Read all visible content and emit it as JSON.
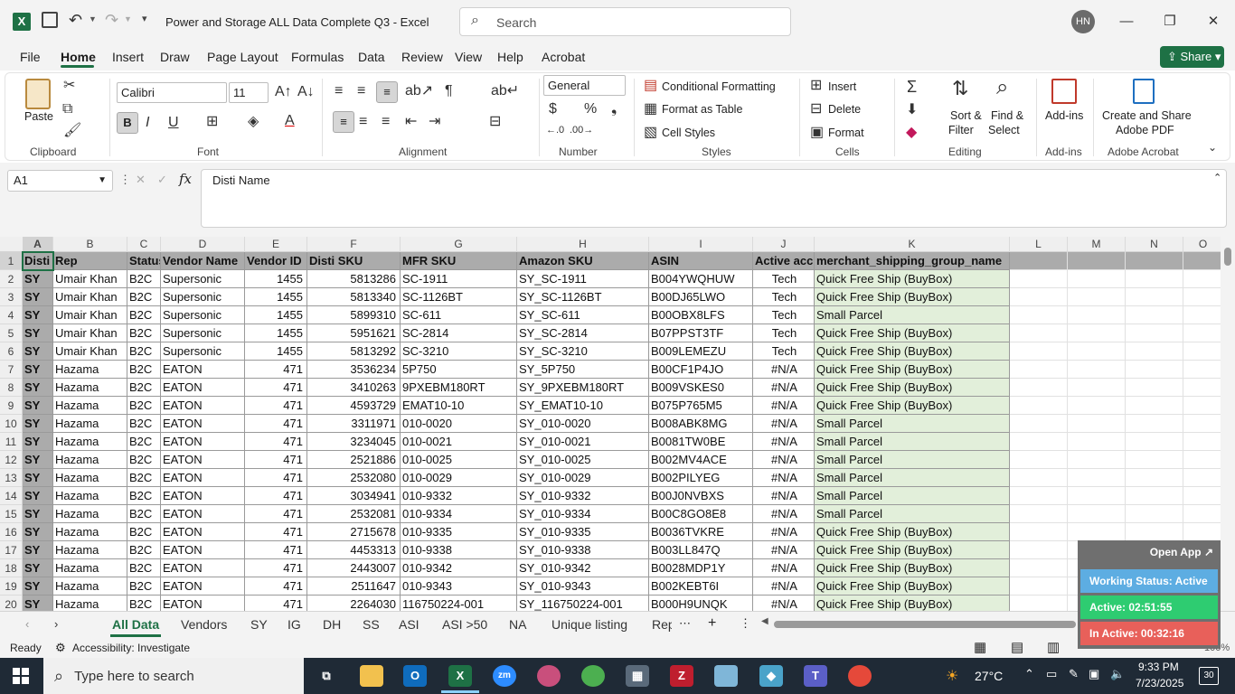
{
  "window": {
    "title": "Power and Storage ALL Data Complete Q3  -  Excel",
    "search_placeholder": "Search",
    "user_initials": "HN"
  },
  "menu": {
    "items": [
      "File",
      "Home",
      "Insert",
      "Draw",
      "Page Layout",
      "Formulas",
      "Data",
      "Review",
      "View",
      "Help",
      "Acrobat"
    ],
    "share_label": "Share"
  },
  "ribbon": {
    "clipboard": {
      "paste": "Paste",
      "label": "Clipboard"
    },
    "font": {
      "name": "Calibri",
      "size": "11",
      "label": "Font"
    },
    "alignment": {
      "label": "Alignment"
    },
    "number": {
      "format": "General",
      "label": "Number"
    },
    "styles": {
      "conditional": "Conditional Formatting",
      "format_table": "Format as Table",
      "cell_styles": "Cell Styles",
      "label": "Styles"
    },
    "cells": {
      "insert": "Insert",
      "delete": "Delete",
      "format": "Format",
      "label": "Cells"
    },
    "editing": {
      "sort1": "Sort &",
      "sort2": "Filter",
      "find1": "Find &",
      "find2": "Select",
      "label": "Editing"
    },
    "addins": {
      "btn": "Add-ins",
      "label": "Add-ins"
    },
    "acrobat": {
      "btn1": "Create and Share",
      "btn2": "Adobe PDF",
      "label": "Adobe Acrobat"
    }
  },
  "formula_bar": {
    "name_box": "A1",
    "value": "Disti Name"
  },
  "columns": [
    "A",
    "B",
    "C",
    "D",
    "E",
    "F",
    "G",
    "H",
    "I",
    "J",
    "K",
    "L",
    "M",
    "N",
    "O"
  ],
  "header_row": [
    "Disti",
    "Rep",
    "Status",
    "Vendor Name",
    "Vendor ID",
    "Disti SKU",
    "MFR SKU",
    "Amazon SKU",
    "ASIN",
    "Active acc",
    "merchant_shipping_group_name"
  ],
  "rows": [
    [
      "SY",
      "Umair Khan",
      "B2C",
      "Supersonic",
      "1455",
      "5813286",
      "SC-1911",
      "SY_SC-1911",
      "B004YWQHUW",
      "Tech",
      "Quick Free Ship (BuyBox)"
    ],
    [
      "SY",
      "Umair Khan",
      "B2C",
      "Supersonic",
      "1455",
      "5813340",
      "SC-1126BT",
      "SY_SC-1126BT",
      "B00DJ65LWO",
      "Tech",
      "Quick Free Ship (BuyBox)"
    ],
    [
      "SY",
      "Umair Khan",
      "B2C",
      "Supersonic",
      "1455",
      "5899310",
      "SC-611",
      "SY_SC-611",
      "B00OBX8LFS",
      "Tech",
      "Small Parcel"
    ],
    [
      "SY",
      "Umair Khan",
      "B2C",
      "Supersonic",
      "1455",
      "5951621",
      "SC-2814",
      "SY_SC-2814",
      "B07PPST3TF",
      "Tech",
      "Quick Free Ship (BuyBox)"
    ],
    [
      "SY",
      "Umair Khan",
      "B2C",
      "Supersonic",
      "1455",
      "5813292",
      "SC-3210",
      "SY_SC-3210",
      "B009LEMEZU",
      "Tech",
      "Quick Free Ship (BuyBox)"
    ],
    [
      "SY",
      "Hazama",
      "B2C",
      "EATON",
      "471",
      "3536234",
      "5P750",
      "SY_5P750",
      "B00CF1P4JO",
      "#N/A",
      "Quick Free Ship (BuyBox)"
    ],
    [
      "SY",
      "Hazama",
      "B2C",
      "EATON",
      "471",
      "3410263",
      "9PXEBM180RT",
      "SY_9PXEBM180RT",
      "B009VSKES0",
      "#N/A",
      "Quick Free Ship (BuyBox)"
    ],
    [
      "SY",
      "Hazama",
      "B2C",
      "EATON",
      "471",
      "4593729",
      "EMAT10-10",
      "SY_EMAT10-10",
      "B075P765M5",
      "#N/A",
      "Quick Free Ship (BuyBox)"
    ],
    [
      "SY",
      "Hazama",
      "B2C",
      "EATON",
      "471",
      "3311971",
      "010-0020",
      "SY_010-0020",
      "B008ABK8MG",
      "#N/A",
      "Small Parcel"
    ],
    [
      "SY",
      "Hazama",
      "B2C",
      "EATON",
      "471",
      "3234045",
      "010-0021",
      "SY_010-0021",
      "B0081TW0BE",
      "#N/A",
      "Small Parcel"
    ],
    [
      "SY",
      "Hazama",
      "B2C",
      "EATON",
      "471",
      "2521886",
      "010-0025",
      "SY_010-0025",
      "B002MV4ACE",
      "#N/A",
      "Small Parcel"
    ],
    [
      "SY",
      "Hazama",
      "B2C",
      "EATON",
      "471",
      "2532080",
      "010-0029",
      "SY_010-0029",
      "B002PILYEG",
      "#N/A",
      "Small Parcel"
    ],
    [
      "SY",
      "Hazama",
      "B2C",
      "EATON",
      "471",
      "3034941",
      "010-9332",
      "SY_010-9332",
      "B00J0NVBXS",
      "#N/A",
      "Small Parcel"
    ],
    [
      "SY",
      "Hazama",
      "B2C",
      "EATON",
      "471",
      "2532081",
      "010-9334",
      "SY_010-9334",
      "B00C8GO8E8",
      "#N/A",
      "Small Parcel"
    ],
    [
      "SY",
      "Hazama",
      "B2C",
      "EATON",
      "471",
      "2715678",
      "010-9335",
      "SY_010-9335",
      "B0036TVKRE",
      "#N/A",
      "Quick Free Ship (BuyBox)"
    ],
    [
      "SY",
      "Hazama",
      "B2C",
      "EATON",
      "471",
      "4453313",
      "010-9338",
      "SY_010-9338",
      "B003LL847Q",
      "#N/A",
      "Quick Free Ship (BuyBox)"
    ],
    [
      "SY",
      "Hazama",
      "B2C",
      "EATON",
      "471",
      "2443007",
      "010-9342",
      "SY_010-9342",
      "B0028MDP1Y",
      "#N/A",
      "Quick Free Ship (BuyBox)"
    ],
    [
      "SY",
      "Hazama",
      "B2C",
      "EATON",
      "471",
      "2511647",
      "010-9343",
      "SY_010-9343",
      "B002KEBT6I",
      "#N/A",
      "Quick Free Ship (BuyBox)"
    ],
    [
      "SY",
      "Hazama",
      "B2C",
      "EATON",
      "471",
      "2264030",
      "116750224-001",
      "SY_116750224-001",
      "B000H9UNQK",
      "#N/A",
      "Quick Free Ship (BuyBox)"
    ]
  ],
  "sheet_tabs": [
    "All Data",
    "Vendors",
    "SY",
    "IG",
    "DH",
    "SS",
    "ASI",
    "ASI >50",
    "NA",
    "Unique listing",
    "Rep"
  ],
  "status": {
    "ready": "Ready",
    "accessibility": "Accessibility: Investigate",
    "zoom": "100%"
  },
  "widget": {
    "open_app": "Open App",
    "working": "Working Status: Active",
    "active": "Active: 02:51:55",
    "inactive": "In Active: 00:32:16"
  },
  "taskbar": {
    "search": "Type here to search",
    "temp": "27°C",
    "time": "9:33 PM",
    "date": "7/23/2025",
    "notif": "30"
  },
  "colors": {
    "excel_green": "#1e7145",
    "header_gray": "#ababab",
    "ship_green": "#e2efda",
    "widget_active": "#2ecc71",
    "widget_inactive": "#e8605a",
    "widget_status": "#5dade2"
  }
}
